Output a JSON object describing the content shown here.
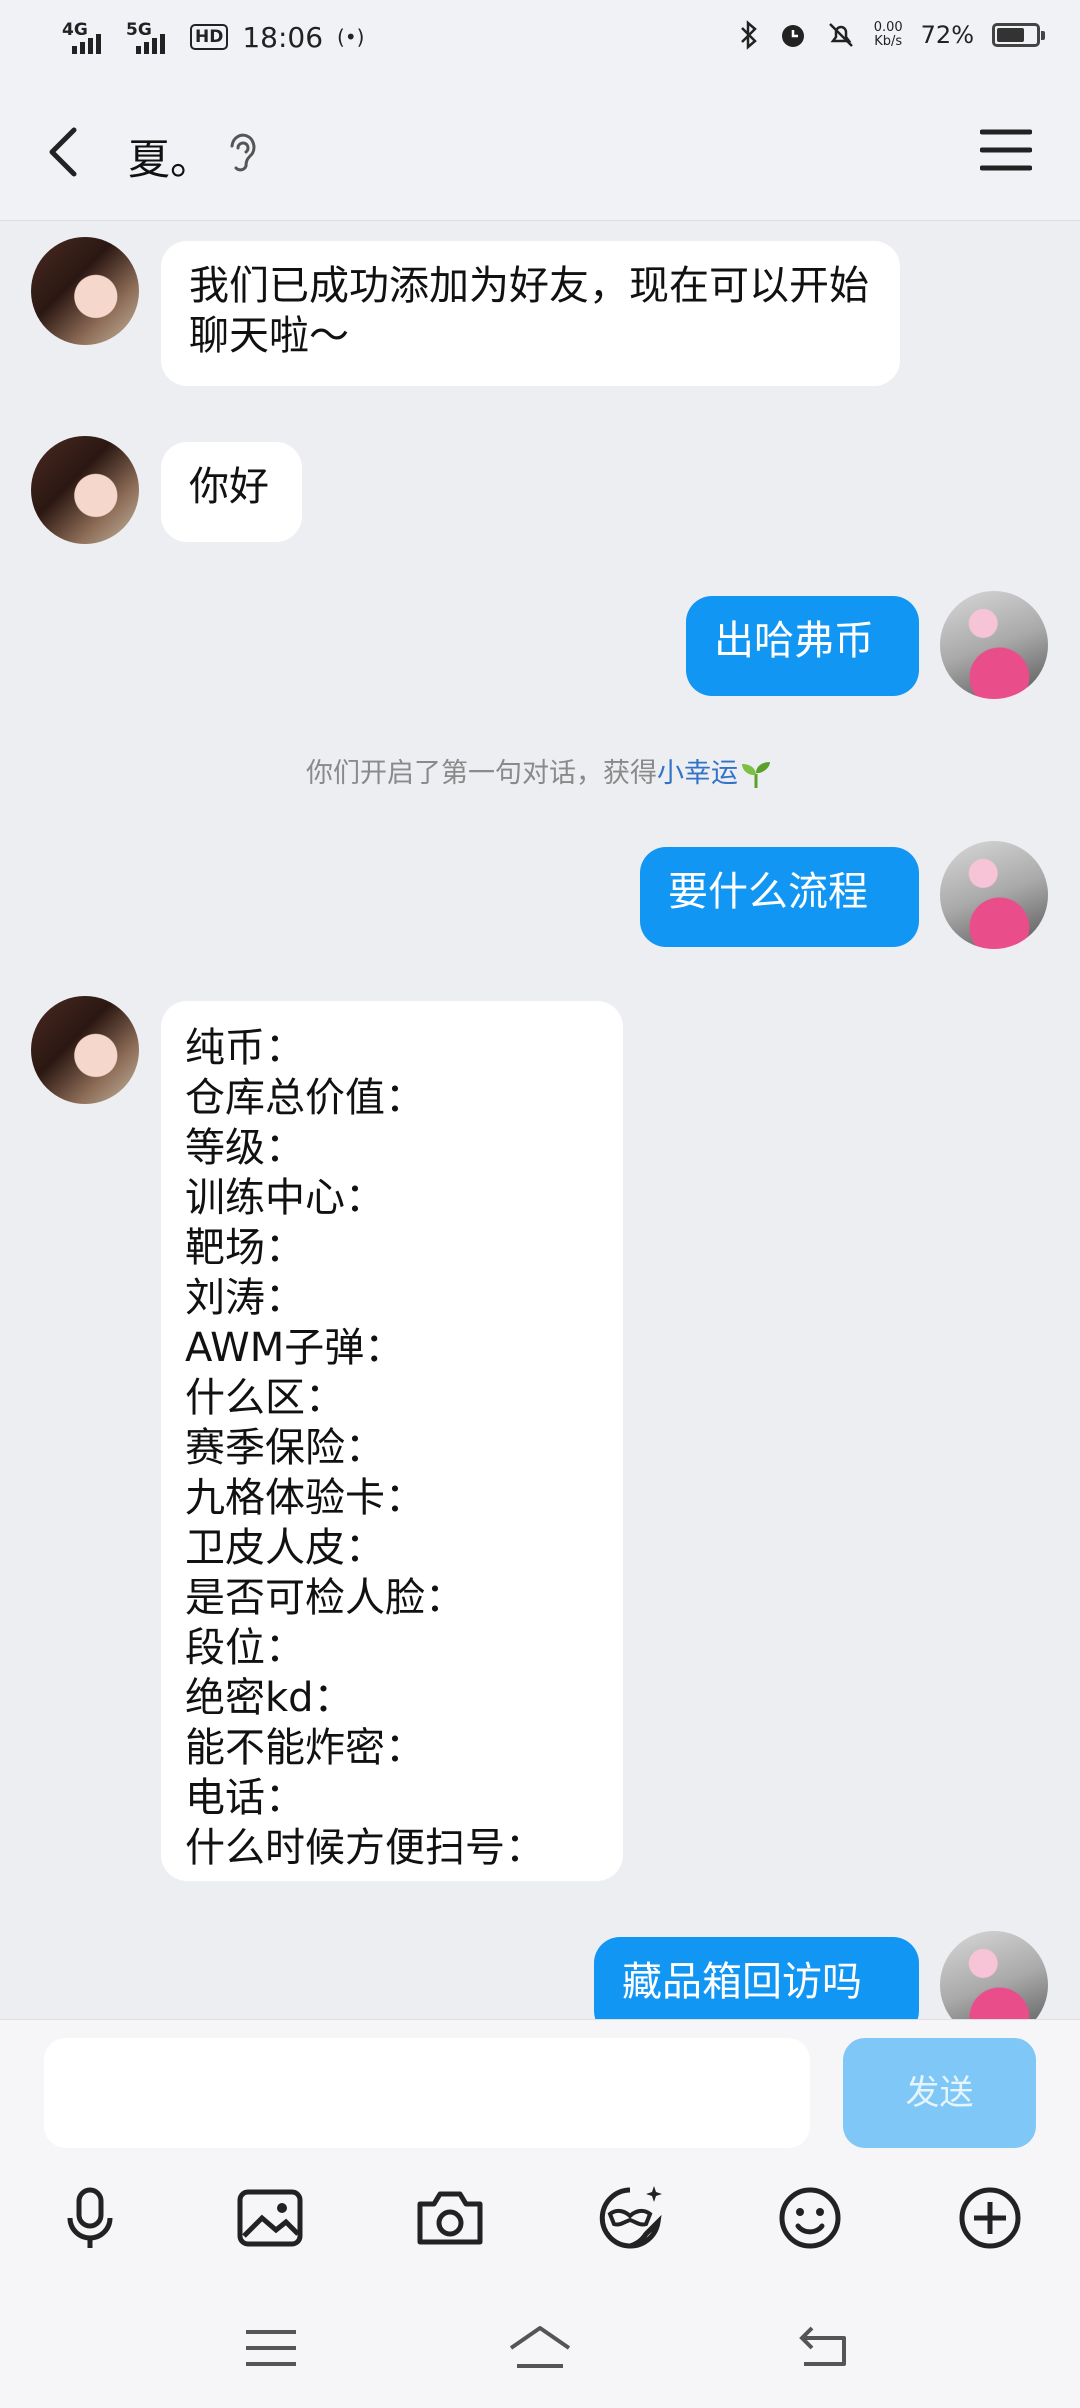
{
  "status": {
    "sig1": "4G",
    "sig2": "5G",
    "hd": "HD",
    "time": "18:06",
    "netspeed_value": "0.00",
    "netspeed_unit": "Kb/s",
    "battery": "72%",
    "battery_level": 0.72
  },
  "header": {
    "contact_name": "夏。",
    "icons": [
      "back-arrow-icon",
      "ear-icon",
      "menu-icon"
    ]
  },
  "messages": {
    "m1": "我们已成功添加为好友，现在可以开始聊天啦～",
    "m2": "你好",
    "m3": "出哈弗币",
    "sys_prefix": "你们开启了第一句对话，获得",
    "sys_link": "小幸运",
    "m4": "要什么流程",
    "list": [
      "纯币：",
      "仓库总价值：",
      "等级：",
      "训练中心：",
      "靶场：",
      "刘涛：",
      "AWM子弹：",
      "什么区：",
      "赛季保险：",
      "九格体验卡：",
      "卫皮人皮：",
      "是否可检人脸：",
      "段位：",
      "绝密kd：",
      "能不能炸密：",
      "电话：",
      "什么时候方便扫号："
    ],
    "m5": "藏品箱回访吗"
  },
  "input": {
    "send_label": "发送",
    "placeholder": ""
  },
  "toolbar": [
    "microphone-icon",
    "image-icon",
    "camera-icon",
    "sticker-icon",
    "emoji-icon",
    "plus-icon"
  ],
  "colors": {
    "outgoing_bubble": "#1296f4",
    "incoming_bubble": "#ffffff",
    "background": "#eceef2",
    "send_button": "#7ec7f7",
    "link": "#3273c8"
  }
}
